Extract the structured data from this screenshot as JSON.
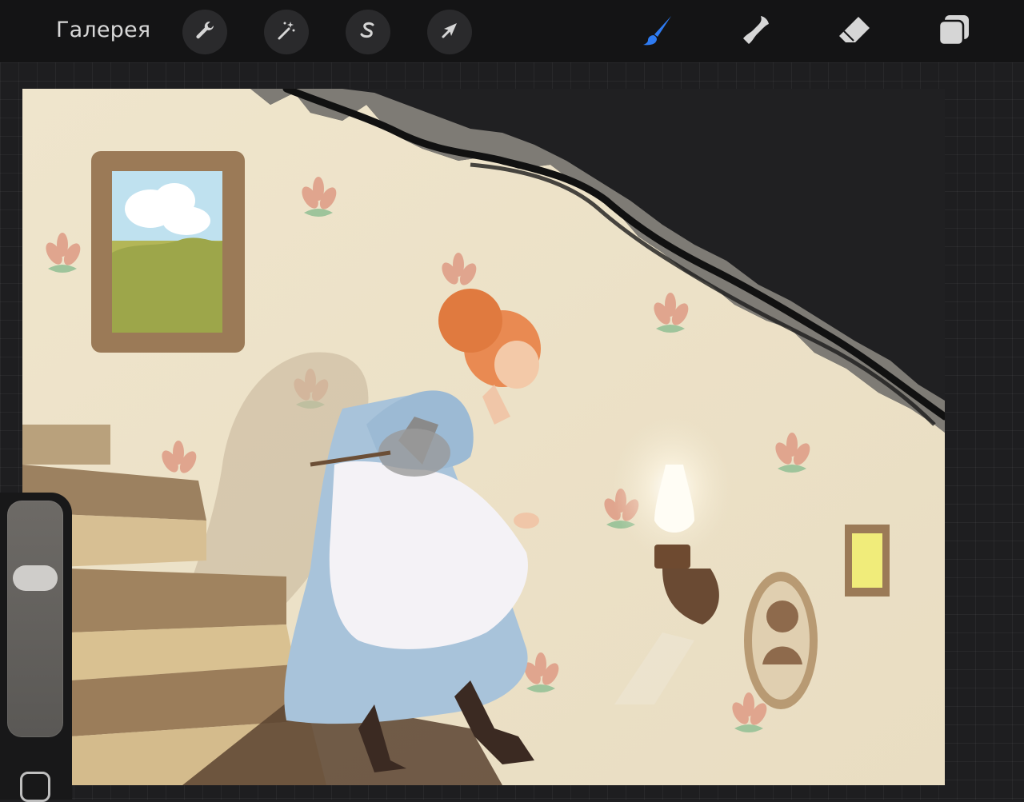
{
  "toolbar": {
    "gallery_label": "Галерея",
    "left_tools": [
      {
        "icon": "wrench-icon",
        "name": "actions"
      },
      {
        "icon": "magic-wand-icon",
        "name": "adjustments"
      },
      {
        "icon": "selection-s-icon",
        "name": "selection"
      },
      {
        "icon": "arrow-cursor-icon",
        "name": "transform"
      }
    ],
    "right_tools": [
      {
        "icon": "brush-icon",
        "name": "paint",
        "active": true
      },
      {
        "icon": "smudge-icon",
        "name": "smudge"
      },
      {
        "icon": "eraser-icon",
        "name": "erase"
      },
      {
        "icon": "layers-icon",
        "name": "layers"
      }
    ]
  },
  "colors": {
    "active_tool": "#2e7bf2",
    "inactive_tool": "#d6d6d6",
    "toolbar_bg": "#141415",
    "canvas_bg": "#ece2c9"
  },
  "sidebar": {
    "brush_size_level": 0.72,
    "modify_button_icon": "square-outline-icon"
  }
}
